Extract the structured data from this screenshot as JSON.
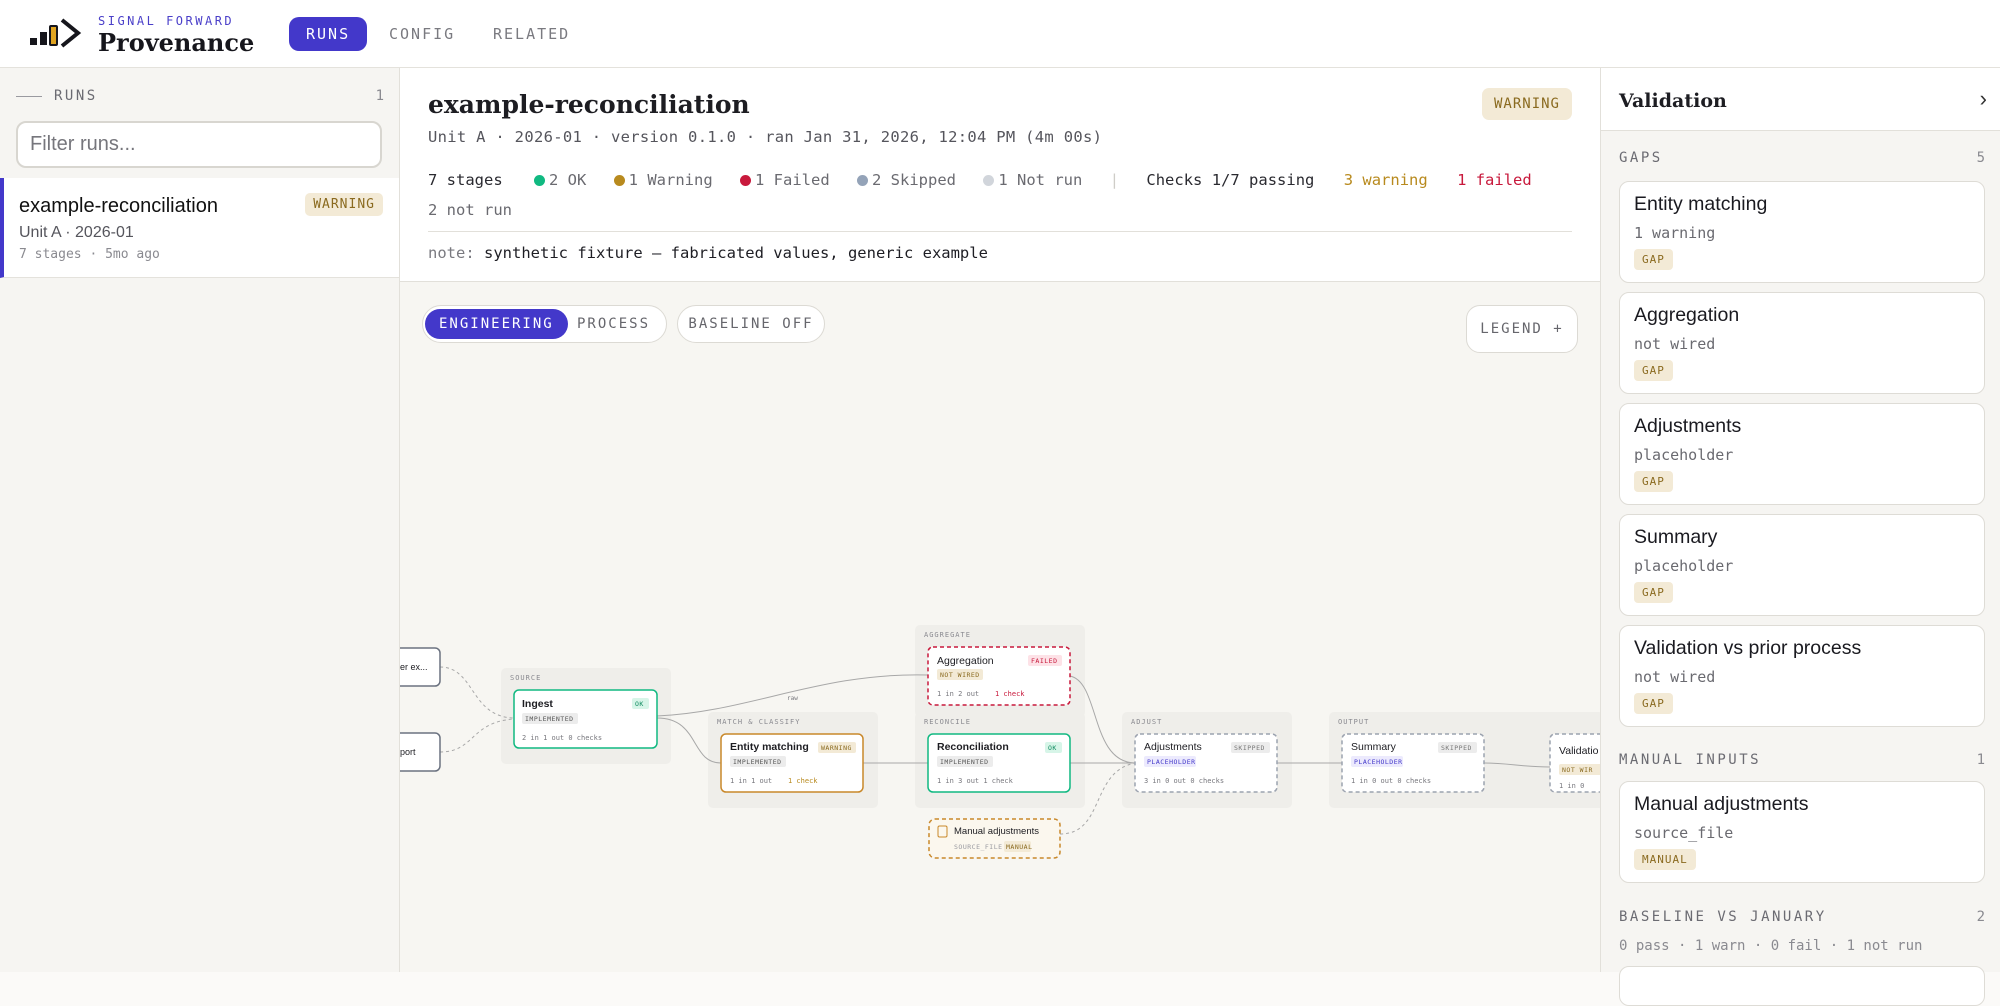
{
  "brand": {
    "kicker": "SIGNAL FORWARD",
    "name": "Provenance"
  },
  "nav": {
    "tabs": [
      {
        "label": "RUNS",
        "active": true
      },
      {
        "label": "CONFIG"
      },
      {
        "label": "RELATED"
      }
    ]
  },
  "runs_panel": {
    "heading": "RUNS",
    "count": "1",
    "filter_placeholder": "Filter runs...",
    "items": [
      {
        "title": "example-reconciliation",
        "subtitle": "Unit A · 2026-01",
        "meta": "7 stages · 5mo ago",
        "badge": "WARNING"
      }
    ]
  },
  "run": {
    "title": "example-reconciliation",
    "badge": "WARNING",
    "info": "Unit A · 2026-01 · version 0.1.0 · ran Jan 31, 2026, 12:04 PM (4m 00s)",
    "stages": "7 stages",
    "stats": [
      {
        "label": "2 OK",
        "color": "#10b981"
      },
      {
        "label": "1 Warning",
        "color": "#b88a1e"
      },
      {
        "label": "1 Failed",
        "color": "#c8193c"
      },
      {
        "label": "2 Skipped",
        "color": "#94a3b8"
      },
      {
        "label": "1 Not run",
        "color": "#d1d5db"
      }
    ],
    "checks": "Checks 1/7 passing",
    "checks_warning": "3 warning",
    "checks_failed": "1 failed",
    "checks_not_run": "2 not run",
    "note_label": "note:",
    "note_text": "synthetic fixture — fabricated values, generic example"
  },
  "canvas": {
    "view_modes": [
      "ENGINEERING",
      "PROCESS"
    ],
    "baseline_toggle": "BASELINE OFF",
    "legend_button": "LEGEND +",
    "groups": [
      "SOURCE",
      "MATCH & CLASSIFY",
      "AGGREGATE",
      "RECONCILE",
      "ADJUST",
      "OUTPUT"
    ],
    "edge_label": "raw",
    "nodes": {
      "left_top": "er ex...",
      "left_bottom": "port",
      "ingest": {
        "title": "Ingest",
        "status": "OK",
        "impl": "IMPLEMENTED",
        "meta": "2 in  1 out  0 checks"
      },
      "entity": {
        "title": "Entity matching",
        "status": "WARNING",
        "impl": "IMPLEMENTED",
        "meta": "1 in  1 out",
        "checks": "1 check"
      },
      "aggregation": {
        "title": "Aggregation",
        "status": "FAILED",
        "impl": "NOT WIRED",
        "meta": "1 in  2 out",
        "checks": "1 check"
      },
      "reconciliation": {
        "title": "Reconciliation",
        "status": "OK",
        "impl": "IMPLEMENTED",
        "meta": "1 in  3 out  1 check"
      },
      "manual": {
        "title": "Manual adjustments",
        "kind": "SOURCE_FILE",
        "tag": "MANUAL"
      },
      "adjustments": {
        "title": "Adjustments",
        "status": "SKIPPED",
        "impl": "PLACEHOLDER",
        "meta": "3 in  0 out  0 checks"
      },
      "summary": {
        "title": "Summary",
        "status": "SKIPPED",
        "impl": "PLACEHOLDER",
        "meta": "1 in  0 out  0 checks"
      },
      "validation": {
        "title": "Validatio",
        "impl": "NOT WIR",
        "meta": "1 in  0"
      }
    }
  },
  "validation_panel": {
    "title": "Validation",
    "sections": [
      {
        "heading": "GAPS",
        "count": "5",
        "cards": [
          {
            "title": "Entity matching",
            "sub": "1 warning",
            "badge": "GAP"
          },
          {
            "title": "Aggregation",
            "sub": "not wired",
            "badge": "GAP"
          },
          {
            "title": "Adjustments",
            "sub": "placeholder",
            "badge": "GAP"
          },
          {
            "title": "Summary",
            "sub": "placeholder",
            "badge": "GAP"
          },
          {
            "title": "Validation vs prior process",
            "sub": "not wired",
            "badge": "GAP"
          }
        ]
      },
      {
        "heading": "MANUAL INPUTS",
        "count": "1",
        "cards": [
          {
            "title": "Manual adjustments",
            "sub": "source_file",
            "badge": "MANUAL"
          }
        ]
      },
      {
        "heading": "BASELINE VS JANUARY",
        "count": "2",
        "summary": "0 pass · 1 warn · 0 fail · 1 not run"
      }
    ]
  }
}
